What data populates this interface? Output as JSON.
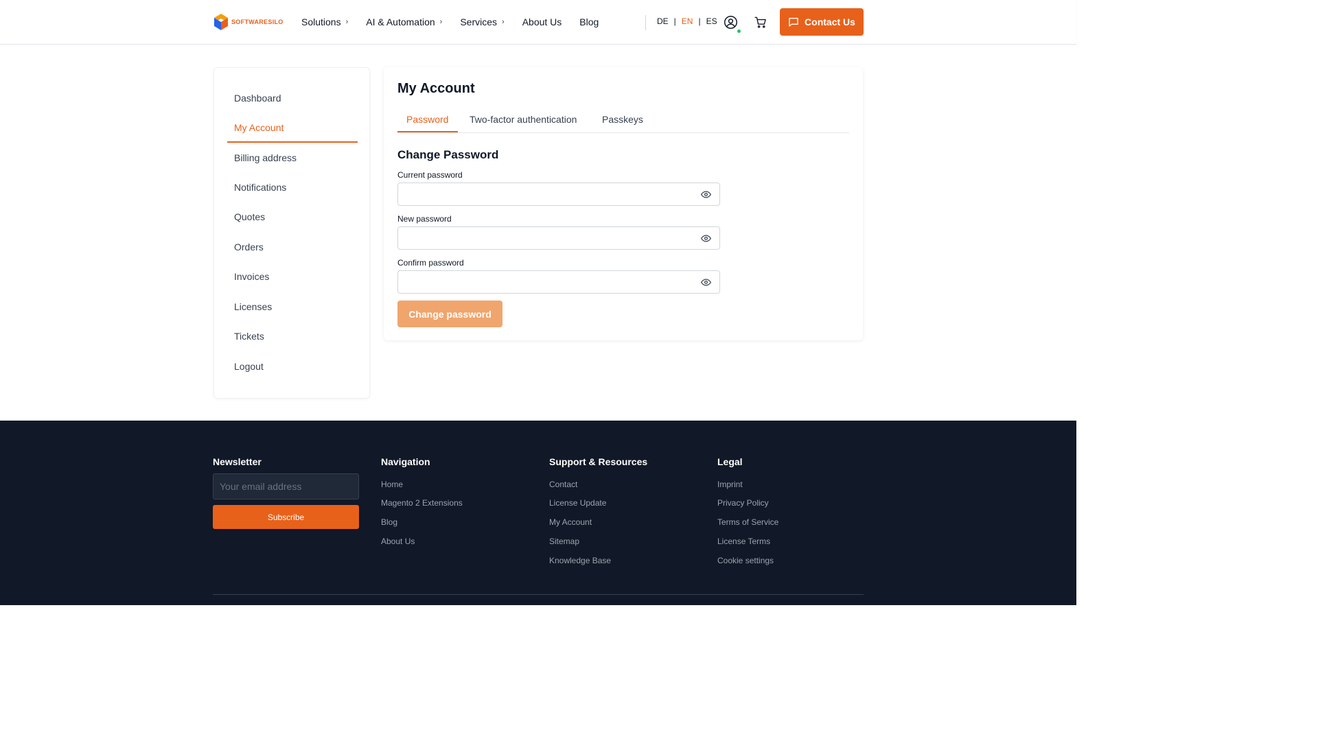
{
  "header": {
    "logo_text": "SOFTWARESILO",
    "nav": [
      {
        "label": "Solutions",
        "has_dropdown": true
      },
      {
        "label": "AI & Automation",
        "has_dropdown": true
      },
      {
        "label": "Services",
        "has_dropdown": true
      },
      {
        "label": "About Us",
        "has_dropdown": false
      },
      {
        "label": "Blog",
        "has_dropdown": false
      }
    ],
    "languages": [
      "DE",
      "EN",
      "ES"
    ],
    "active_language": "EN",
    "contact_label": "Contact Us",
    "brand_color": "#e8611a",
    "status_color": "#22c55e"
  },
  "sidebar": {
    "items": [
      {
        "label": "Dashboard"
      },
      {
        "label": "My Account",
        "active": true
      },
      {
        "label": "Billing address"
      },
      {
        "label": "Notifications"
      },
      {
        "label": "Quotes"
      },
      {
        "label": "Orders"
      },
      {
        "label": "Invoices"
      },
      {
        "label": "Licenses"
      },
      {
        "label": "Tickets"
      },
      {
        "label": "Logout"
      }
    ]
  },
  "main": {
    "title": "My Account",
    "tabs": [
      {
        "label": "Password",
        "active": true
      },
      {
        "label": "Two-factor authentication"
      },
      {
        "label": "Passkeys"
      }
    ],
    "section_title": "Change Password",
    "fields": [
      {
        "label": "Current password",
        "value": ""
      },
      {
        "label": "New password",
        "value": ""
      },
      {
        "label": "Confirm password",
        "value": ""
      }
    ],
    "submit_label": "Change password"
  },
  "footer": {
    "newsletter": {
      "heading": "Newsletter",
      "placeholder": "Your email address",
      "button_label": "Subscribe"
    },
    "navigation": {
      "heading": "Navigation",
      "links": [
        "Home",
        "Magento 2 Extensions",
        "Blog",
        "About Us"
      ]
    },
    "support": {
      "heading": "Support & Resources",
      "links": [
        "Contact",
        "License Update",
        "My Account",
        "Sitemap",
        "Knowledge Base"
      ]
    },
    "legal": {
      "heading": "Legal",
      "links": [
        "Imprint",
        "Privacy Policy",
        "Terms of Service",
        "License Terms",
        "Cookie settings"
      ]
    }
  }
}
